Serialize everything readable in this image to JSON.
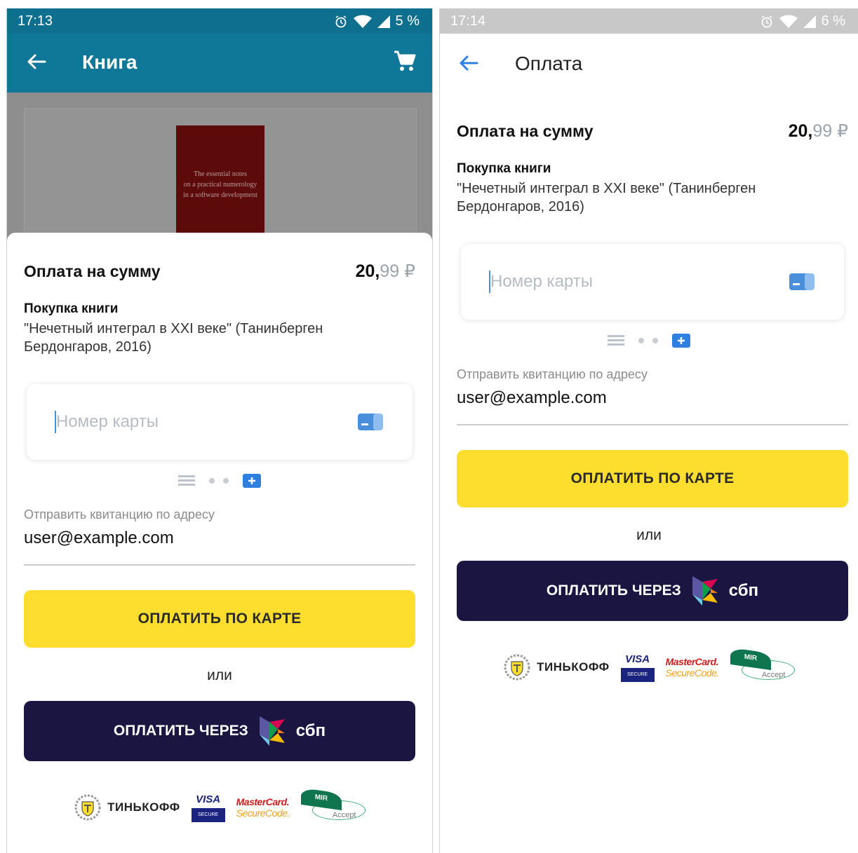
{
  "screens": [
    {
      "status": {
        "time": "17:13",
        "battery": "5 %"
      },
      "appbar": {
        "title": "Книга"
      },
      "book": {
        "cover_lines": [
          "The essential notes",
          "on a practical numerology",
          "in a software development"
        ]
      },
      "payment": {
        "sum_label": "Оплата на сумму",
        "amount_main": "20,",
        "amount_cents": "99",
        "currency": "₽",
        "purchase_title": "Покупка книги",
        "purchase_desc": "\"Нечетный интеграл в XXI веке\" (Танинберген Бердонгаров, 2016)",
        "card_placeholder": "Номер карты",
        "receipt_label": "Отправить квитанцию по адресу",
        "receipt_email": "user@example.com",
        "pay_card_label": "ОПЛАТИТЬ ПО КАРТЕ",
        "or_label": "или",
        "pay_sbp_label": "ОПЛАТИТЬ ЧЕРЕЗ",
        "sbp_text": "сбп",
        "tinkoff_text": "ТИНЬКОФФ",
        "visa_text": "VISA",
        "visa_sub": "SECURE",
        "mc_line1": "MasterCard.",
        "mc_line2": "SecureCode.",
        "mir_text": "MIR",
        "mir_accept": "Accept"
      }
    },
    {
      "status": {
        "time": "17:14",
        "battery": "6 %"
      },
      "appbar": {
        "title": "Оплата"
      },
      "payment": {
        "sum_label": "Оплата на сумму",
        "amount_main": "20,",
        "amount_cents": "99",
        "currency": "₽",
        "purchase_title": "Покупка книги",
        "purchase_desc": "\"Нечетный интеграл в XXI веке\" (Танинберген Бердонгаров, 2016)",
        "card_placeholder": "Номер карты",
        "receipt_label": "Отправить квитанцию по адресу",
        "receipt_email": "user@example.com",
        "pay_card_label": "ОПЛАТИТЬ ПО КАРТЕ",
        "or_label": "или",
        "pay_sbp_label": "ОПЛАТИТЬ ЧЕРЕЗ",
        "sbp_text": "сбп",
        "tinkoff_text": "ТИНЬКОФФ",
        "visa_text": "VISA",
        "visa_sub": "SECURE",
        "mc_line1": "MasterCard.",
        "mc_line2": "SecureCode.",
        "mir_text": "MIR",
        "mir_accept": "Accept"
      }
    }
  ],
  "colors": {
    "appbar": "#0f7797",
    "pay_card_button": "#fddd2d",
    "pay_sbp_button": "#1b1541",
    "accent_blue": "#4a8fdc"
  },
  "icons": [
    "back-arrow-icon",
    "cart-icon",
    "alarm-icon",
    "wifi-icon",
    "signal-icon",
    "card-icon",
    "list-icon",
    "add-card-icon",
    "sbp-logo-icon",
    "tinkoff-emblem-icon"
  ]
}
